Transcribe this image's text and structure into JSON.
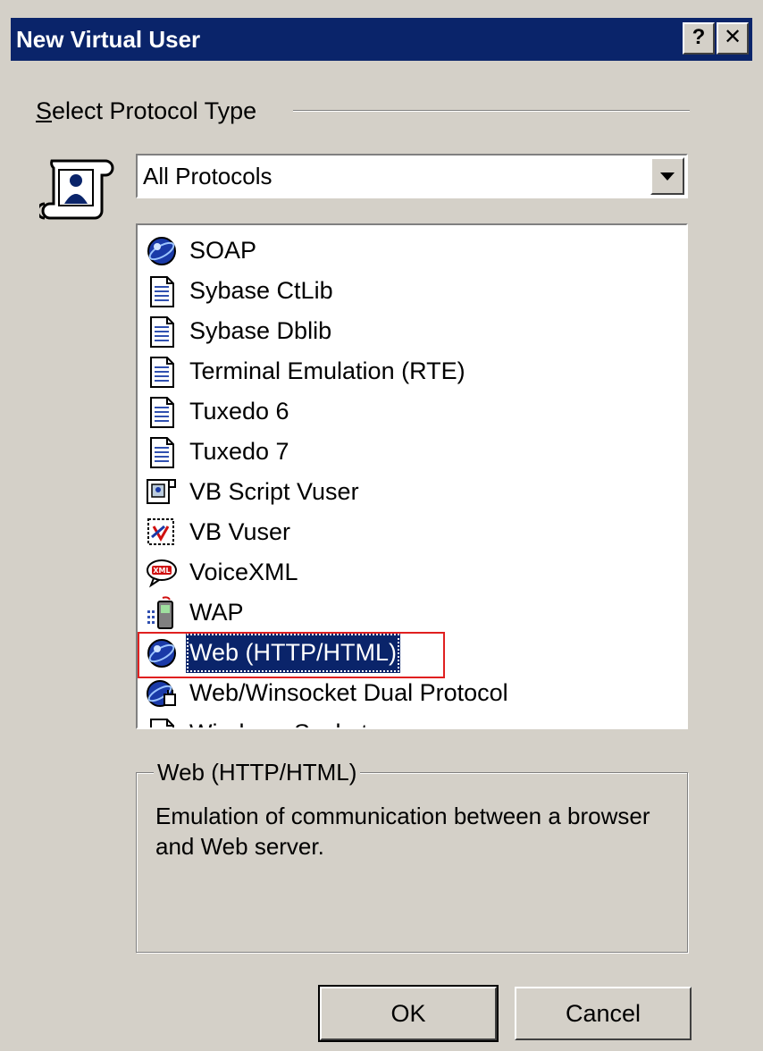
{
  "window": {
    "title": "New Virtual User",
    "help_label": "?",
    "close_label": "✕"
  },
  "protocol_group": {
    "label_accel": "S",
    "label_rest": "elect Protocol Type"
  },
  "filter_combo": {
    "value": "All Protocols"
  },
  "protocol_list": {
    "items": [
      {
        "label": "SOAP",
        "icon": "globe-icon"
      },
      {
        "label": "Sybase CtLib",
        "icon": "document-icon"
      },
      {
        "label": "Sybase Dblib",
        "icon": "document-icon"
      },
      {
        "label": "Terminal Emulation (RTE)",
        "icon": "document-icon"
      },
      {
        "label": "Tuxedo 6",
        "icon": "document-icon"
      },
      {
        "label": "Tuxedo 7",
        "icon": "document-icon"
      },
      {
        "label": "VB Script Vuser",
        "icon": "script-icon"
      },
      {
        "label": "VB Vuser",
        "icon": "vb-icon"
      },
      {
        "label": "VoiceXML",
        "icon": "xml-bubble-icon"
      },
      {
        "label": "WAP",
        "icon": "phone-icon"
      },
      {
        "label": "Web (HTTP/HTML)",
        "icon": "globe-icon"
      },
      {
        "label": "Web/Winsocket Dual Protocol",
        "icon": "globe-plug-icon"
      },
      {
        "label": "Windows Sockets",
        "icon": "document-icon"
      }
    ],
    "selected_index": 10
  },
  "description": {
    "title": "Web (HTTP/HTML)",
    "text": "Emulation of communication between a browser and Web server."
  },
  "buttons": {
    "ok": "OK",
    "cancel": "Cancel"
  },
  "colors": {
    "dialog_bg": "#d4d0c8",
    "titlebar_bg": "#0a246a",
    "selection_bg": "#0a246a",
    "annotation_red": "#e02020"
  }
}
